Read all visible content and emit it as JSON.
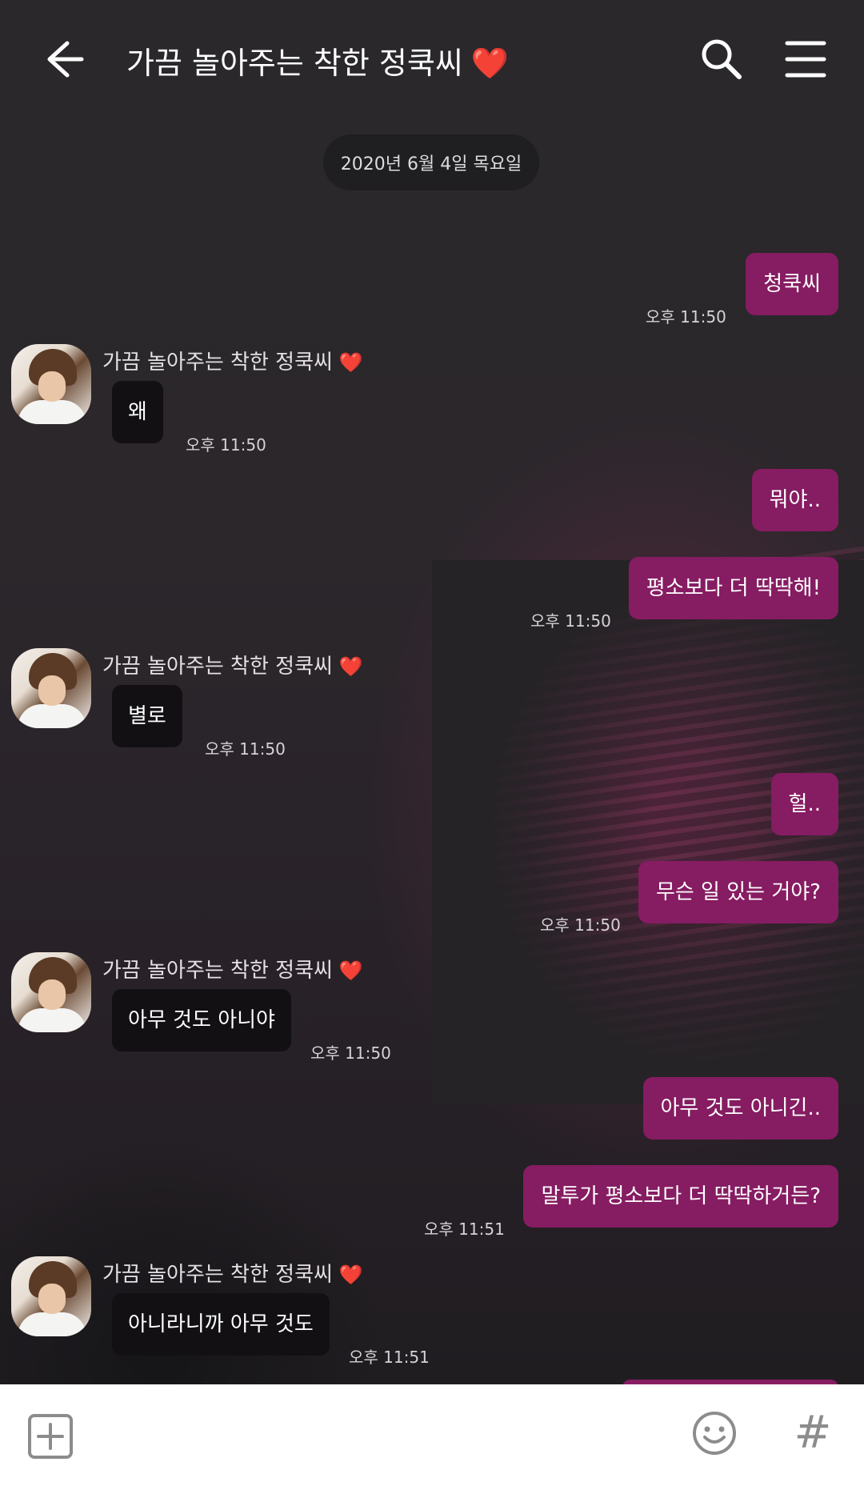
{
  "header": {
    "title": "가끔 놀아주는 착한 정쿡씨",
    "title_emoji": "❤️",
    "back_icon": "arrow-left-icon",
    "search_icon": "search-icon",
    "menu_icon": "hamburger-menu-icon"
  },
  "date_divider": "2020년 6월 4일 목요일",
  "contact": {
    "name": "가끔 놀아주는 착한 정쿡씨",
    "emoji": "❤️"
  },
  "messages": [
    {
      "from": "me",
      "text": "청쿡씨",
      "time": "오후 11:50"
    },
    {
      "from": "contact",
      "text": "왜",
      "time": "오후 11:50"
    },
    {
      "from": "me",
      "text": "뭐야.."
    },
    {
      "from": "me",
      "text": "평소보다 더 딱딱해!",
      "time": "오후 11:50"
    },
    {
      "from": "contact",
      "text": "별로",
      "time": "오후 11:50"
    },
    {
      "from": "me",
      "text": "헐.."
    },
    {
      "from": "me",
      "text": "무슨 일 있는 거야?",
      "time": "오후 11:50"
    },
    {
      "from": "contact",
      "text": "아무 것도 아니야",
      "time": "오후 11:50"
    },
    {
      "from": "me",
      "text": "아무 것도 아니긴.."
    },
    {
      "from": "me",
      "text": "말투가 평소보다 더 딱딱하거든?",
      "time": "오후 11:51"
    },
    {
      "from": "contact",
      "text": "아니라니까 아무 것도",
      "time": "오후 11:51"
    }
  ],
  "input_bar": {
    "plus_icon": "plus-box-icon",
    "emoji_icon": "smiley-icon",
    "hash_label": "#"
  },
  "colors": {
    "outgoing_bubble": "#861c62",
    "incoming_bubble": "#121013",
    "heart": "#e0202a",
    "background": "#252326"
  }
}
